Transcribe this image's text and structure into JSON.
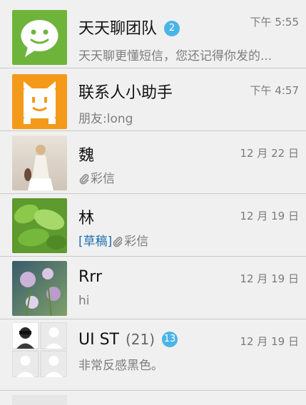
{
  "conversations": [
    {
      "name": "天天聊团队",
      "badge": "2",
      "time": "下午 5:55",
      "snippet": "天天聊更懂短信，您还记得你发的..."
    },
    {
      "name": "联系人小助手",
      "time": "下午 4:57",
      "snippet": "朋友:long"
    },
    {
      "name": "魏",
      "time": "12 月 22 日",
      "snippet": "彩信"
    },
    {
      "name": "林",
      "time": "12 月 19 日",
      "draft_label": "[草稿]",
      "snippet": "彩信"
    },
    {
      "name": "Rrr",
      "time": "12 月 19 日",
      "snippet": "hi"
    },
    {
      "name": "UI ST",
      "count": "(21)",
      "badge": "13",
      "time": "12 月 19 日",
      "snippet": "非常反感黑色。"
    }
  ],
  "colors": {
    "badge": "#4ab4e6",
    "draft": "#1f6fb0",
    "app_icon_green": "#6fb43a",
    "app_icon_orange": "#f39a1a"
  },
  "icons": [
    "chat-bubble-icon",
    "robot-assistant-icon",
    "attachment-clip-icon",
    "person-placeholder-icon"
  ]
}
